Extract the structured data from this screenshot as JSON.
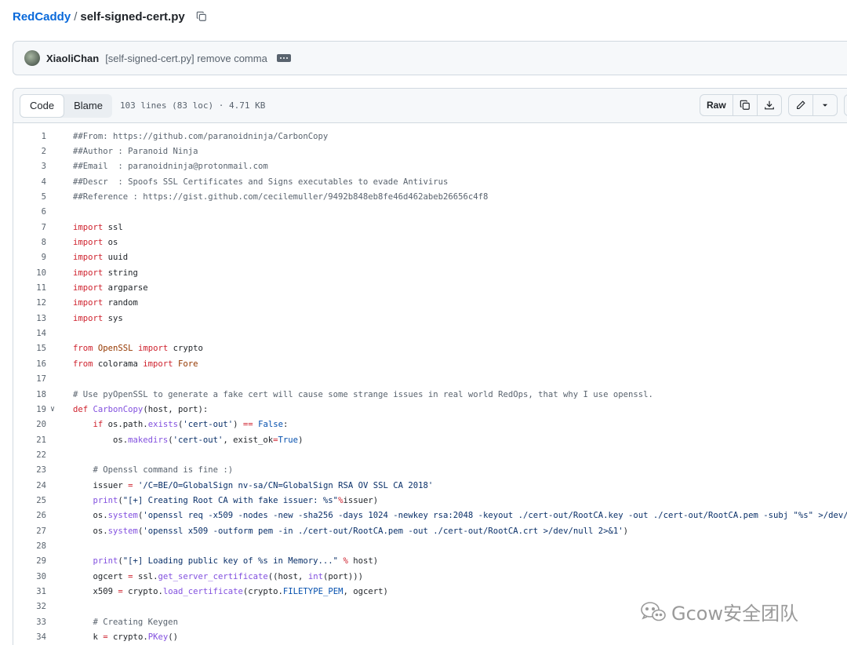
{
  "breadcrumb": {
    "repo": "RedCaddy",
    "sep": "/",
    "file": "self-signed-cert.py"
  },
  "commit": {
    "author": "XiaoliChan",
    "message": "[self-signed-cert.py] remove comma"
  },
  "file_header": {
    "tabs": [
      "Code",
      "Blame"
    ],
    "meta": "103 lines (83 loc) · 4.71 KB",
    "raw_label": "Raw"
  },
  "code_lines": [
    {
      "n": "1",
      "html": "<span class=\"cm\">##From: https://github.com/paranoidninja/CarbonCopy</span>"
    },
    {
      "n": "2",
      "html": "<span class=\"cm\">##Author : Paranoid Ninja</span>"
    },
    {
      "n": "3",
      "html": "<span class=\"cm\">##Email  : paranoidninja@protonmail.com</span>"
    },
    {
      "n": "4",
      "html": "<span class=\"cm\">##Descr  : Spoofs SSL Certificates and Signs executables to evade Antivirus</span>"
    },
    {
      "n": "5",
      "html": "<span class=\"cm\">##Reference : https://gist.github.com/cecilemuller/9492b848eb8fe46d462abeb26656c4f8</span>"
    },
    {
      "n": "6",
      "html": ""
    },
    {
      "n": "7",
      "html": "<span class=\"kw\">import</span> ssl"
    },
    {
      "n": "8",
      "html": "<span class=\"kw\">import</span> os"
    },
    {
      "n": "9",
      "html": "<span class=\"kw\">import</span> uuid"
    },
    {
      "n": "10",
      "html": "<span class=\"kw\">import</span> string"
    },
    {
      "n": "11",
      "html": "<span class=\"kw\">import</span> argparse"
    },
    {
      "n": "12",
      "html": "<span class=\"kw\">import</span> random"
    },
    {
      "n": "13",
      "html": "<span class=\"kw\">import</span> sys"
    },
    {
      "n": "14",
      "html": ""
    },
    {
      "n": "15",
      "html": "<span class=\"kw\">from</span> <span class=\"en\">OpenSSL</span> <span class=\"kw\">import</span> crypto"
    },
    {
      "n": "16",
      "html": "<span class=\"kw\">from</span> colorama <span class=\"kw\">import</span> <span class=\"en\">Fore</span>"
    },
    {
      "n": "17",
      "html": ""
    },
    {
      "n": "18",
      "html": "<span class=\"cm\"># Use pyOpenSSL to generate a fake cert will cause some strange issues in real world RedOps, that why I use openssl.</span>"
    },
    {
      "n": "19",
      "fold": true,
      "html": "<span class=\"kw\">def</span> <span class=\"fn\">CarbonCopy</span>(host, port):"
    },
    {
      "n": "20",
      "html": "    <span class=\"kw\">if</span> os.path.<span class=\"fn\">exists</span>(<span class=\"st\">'cert-out'</span>) <span class=\"kw\">==</span> <span class=\"cn\">False</span>:"
    },
    {
      "n": "21",
      "html": "        os.<span class=\"fn\">makedirs</span>(<span class=\"st\">'cert-out'</span>, exist_ok<span class=\"kw\">=</span><span class=\"cn\">True</span>)"
    },
    {
      "n": "22",
      "html": ""
    },
    {
      "n": "23",
      "html": "    <span class=\"cm\"># Openssl command is fine :)</span>"
    },
    {
      "n": "24",
      "html": "    issuer <span class=\"kw\">=</span> <span class=\"st\">'/C=BE/O=GlobalSign nv-sa/CN=GlobalSign RSA OV SSL CA 2018'</span>"
    },
    {
      "n": "25",
      "html": "    <span class=\"fn\">print</span>(<span class=\"st\">\"[+] Creating Root CA with fake issuer: %s\"</span><span class=\"kw\">%</span>issuer)"
    },
    {
      "n": "26",
      "html": "    os.<span class=\"fn\">system</span>(<span class=\"st\">'openssl req -x509 -nodes -new -sha256 -days 1024 -newkey rsa:2048 -keyout ./cert-out/RootCA.key -out ./cert-out/RootCA.pem -subj \"%s\" &gt;/dev/</span>"
    },
    {
      "n": "27",
      "html": "    os.<span class=\"fn\">system</span>(<span class=\"st\">'openssl x509 -outform pem -in ./cert-out/RootCA.pem -out ./cert-out/RootCA.crt &gt;/dev/null 2&gt;&amp;1'</span>)"
    },
    {
      "n": "28",
      "html": ""
    },
    {
      "n": "29",
      "html": "    <span class=\"fn\">print</span>(<span class=\"st\">\"[+] Loading public key of %s in Memory...\"</span> <span class=\"kw\">%</span> host)"
    },
    {
      "n": "30",
      "html": "    ogcert <span class=\"kw\">=</span> ssl.<span class=\"fn\">get_server_certificate</span>((host, <span class=\"fn\">int</span>(port)))"
    },
    {
      "n": "31",
      "html": "    x509 <span class=\"kw\">=</span> crypto.<span class=\"fn\">load_certificate</span>(crypto.<span class=\"cn\">FILETYPE_PEM</span>, ogcert)"
    },
    {
      "n": "32",
      "html": ""
    },
    {
      "n": "33",
      "html": "    <span class=\"cm\"># Creating Keygen</span>"
    },
    {
      "n": "34",
      "html": "    k <span class=\"kw\">=</span> crypto.<span class=\"fn\">PKey</span>()"
    }
  ],
  "watermark": {
    "text": "Gcow安全团队"
  },
  "icons": [
    "copy-icon",
    "kebab-icon",
    "copy-raw-icon",
    "download-icon",
    "pencil-icon",
    "caret-down-icon",
    "symbols-panel-icon",
    "chevron-down-icon",
    "wechat-icon"
  ]
}
